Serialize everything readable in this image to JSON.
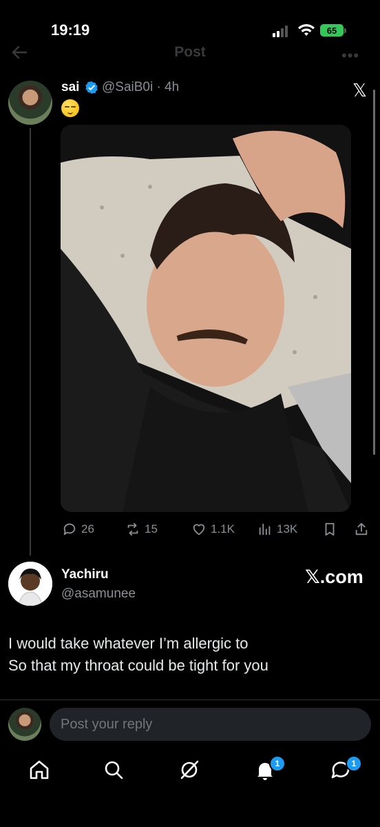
{
  "status_bar": {
    "time": "19:19",
    "battery": "65"
  },
  "header": {
    "title": "Post"
  },
  "tweet": {
    "name": "sai",
    "handle_time": "@SaiB0i · 4h",
    "emoji": "relieved-face",
    "metrics": {
      "replies": "26",
      "reposts": "15",
      "likes": "1.1K",
      "views": "13K"
    }
  },
  "quoted": {
    "name": "Yachiru",
    "handle": "@asamunee",
    "site": "𝕏.com",
    "text_line1": "I would take whatever I’m allergic to",
    "text_line2": "So that my throat could be tight for you"
  },
  "reply": {
    "placeholder": "Post your reply"
  },
  "nav": {
    "notifications_badge": "1",
    "messages_badge": "1"
  },
  "colors": {
    "accent": "#1d9bf0",
    "background": "#000000",
    "muted": "#8b8f94"
  }
}
